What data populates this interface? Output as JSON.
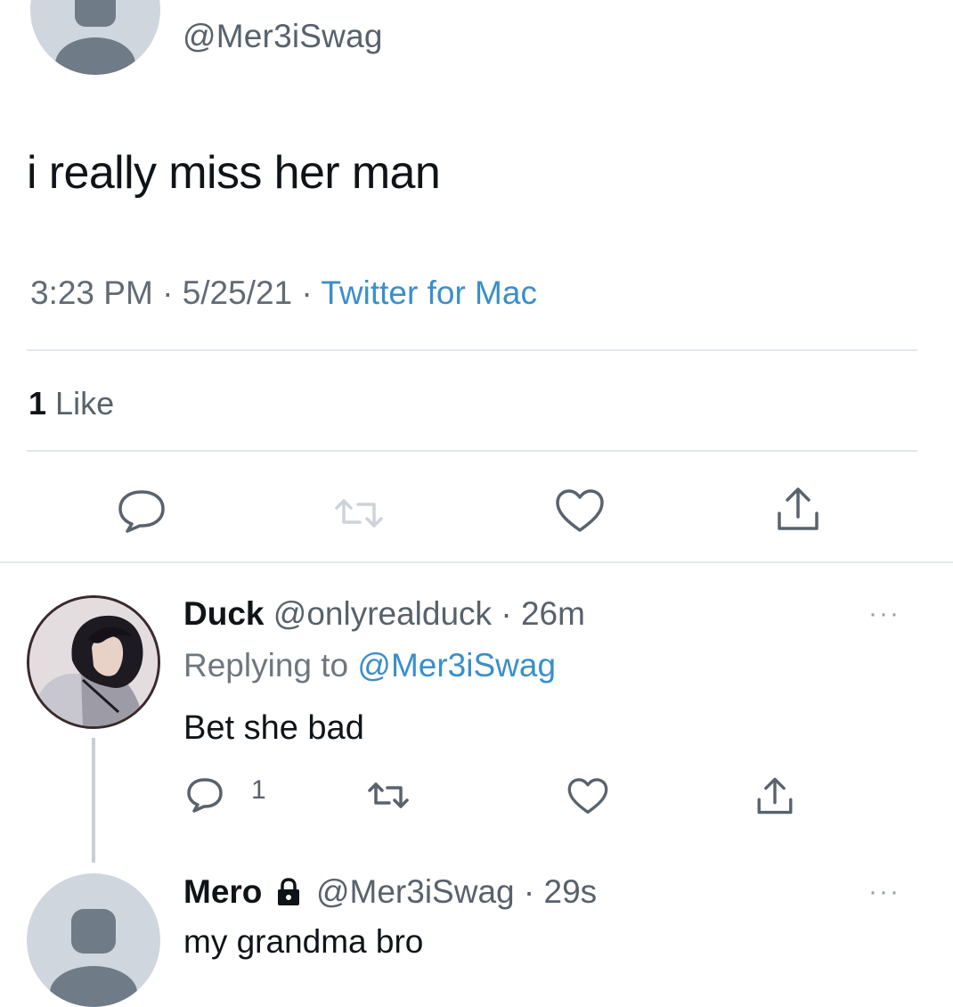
{
  "tweet": {
    "handle": "@Mer3iSwag",
    "text": "i really miss her man",
    "time": "3:23 PM",
    "date": "5/25/21",
    "source": "Twitter for Mac",
    "like_count": "1",
    "like_label": "Like"
  },
  "reply": {
    "name": "Duck",
    "handle": "@onlyrealduck",
    "age": "26m",
    "replying_label": "Replying to",
    "replying_to": "@Mer3iSwag",
    "text": "Bet she bad",
    "reply_count": "1"
  },
  "next_tweet": {
    "name": "Mero",
    "handle": "@Mer3iSwag",
    "age": "29s",
    "text": "my grandma bro"
  },
  "separator": "·",
  "more_label": "···",
  "icons": {
    "reply": "speech-bubble-icon",
    "retweet": "retweet-icon",
    "like": "heart-icon",
    "share": "share-icon",
    "lock": "lock-icon"
  },
  "colors": {
    "link": "#3a8fc9",
    "muted": "#57626c",
    "text": "#0f1419"
  }
}
